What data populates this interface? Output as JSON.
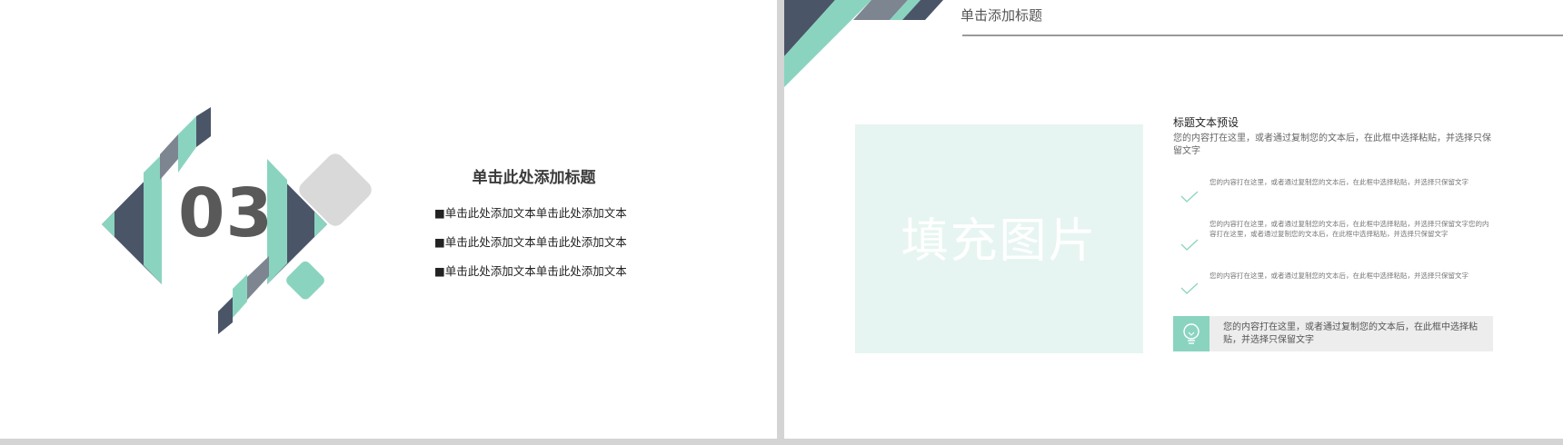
{
  "left_slide": {
    "section_number": "03",
    "title": "单击此处添加标题",
    "bullets": [
      "■单击此处添加文本单击此处添加文本",
      "■单击此处添加文本单击此处添加文本",
      "■单击此处添加文本单击此处添加文本"
    ]
  },
  "right_slide": {
    "header_title": "单击添加标题",
    "image_placeholder": "填充图片",
    "text_heading": "标题文本预设",
    "text_desc": "您的内容打在这里，或者通过复制您的文本后，在此框中选择粘贴，并选择只保留文字",
    "checklist": [
      {
        "icon": "check-icon",
        "text": "您的内容打在这里，或者通过复制您的文本后，在此框中选择粘贴，并选择只保留文字"
      },
      {
        "icon": "check-icon",
        "text": "您的内容打在这里，或者通过复制您的文本后，在此框中选择粘贴，并选择只保留文字您的内容打在这里，或者通过复制您的文本后，在此框中选择粘贴，并选择只保留文字"
      },
      {
        "icon": "check-icon",
        "text": "您的内容打在这里，或者通过复制您的文本后，在此框中选择粘贴，并选择只保留文字"
      }
    ],
    "tip_icon": "lightbulb-icon",
    "tip_text": "您的内容打在这里，或者通过复制您的文本后，在此框中选择粘贴，并选择只保留文字"
  },
  "colors": {
    "mint": "#8ad4bf",
    "slate": "#4a5568",
    "gray_blue": "#7d8591",
    "light_gray": "#d9d9d9",
    "placeholder_bg": "#e6f5f1"
  }
}
